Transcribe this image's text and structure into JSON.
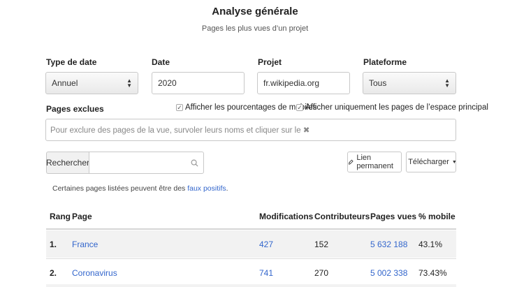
{
  "header": {
    "title": "Analyse générale",
    "subtitle": "Pages les plus vues d’un projet"
  },
  "form": {
    "date_type_label": "Type de date",
    "date_type_value": "Annuel",
    "date_label": "Date",
    "date_value": "2020",
    "project_label": "Projet",
    "project_value": "fr.wikipedia.org",
    "platform_label": "Plateforme",
    "platform_value": "Tous",
    "excluded_label": "Pages exclues",
    "show_mobile_pct": "Afficher les pourcentages de mobiles",
    "main_namespace_only": "Afficher uniquement les pages de l’espace principal",
    "excluded_placeholder": "Pour exclure des pages de la vue, survoler leurs noms et cliquer sur le ✖"
  },
  "toolbar": {
    "search_label": "Rechercher",
    "permalink_label": "Lien permanent",
    "download_label": "Télécharger"
  },
  "note": {
    "text": "Certaines pages listées peuvent être des ",
    "link": "faux positifs",
    "end": "."
  },
  "table": {
    "headers": {
      "rank": "Rang",
      "page": "Page",
      "edits": "Modifications",
      "contributors": "Contributeurs",
      "pageviews": "Pages vues",
      "mobile": "% mobile"
    },
    "rows": [
      {
        "rank": "1.",
        "page": "France",
        "edits": "427",
        "contributors": "152",
        "pageviews": "5 632 188",
        "mobile": "43.1%"
      },
      {
        "rank": "2.",
        "page": "Coronavirus",
        "edits": "741",
        "contributors": "270",
        "pageviews": "5 002 338",
        "mobile": "73.43%"
      }
    ]
  },
  "icons": {
    "search": "search-icon",
    "link": "link-icon",
    "download": "download-icon",
    "caret": "caret-down-icon",
    "check": "checkbox-icon"
  },
  "colors": {
    "link": "#3366cc",
    "row_alt": "#f2f2f2",
    "border": "#c8c8c8"
  }
}
